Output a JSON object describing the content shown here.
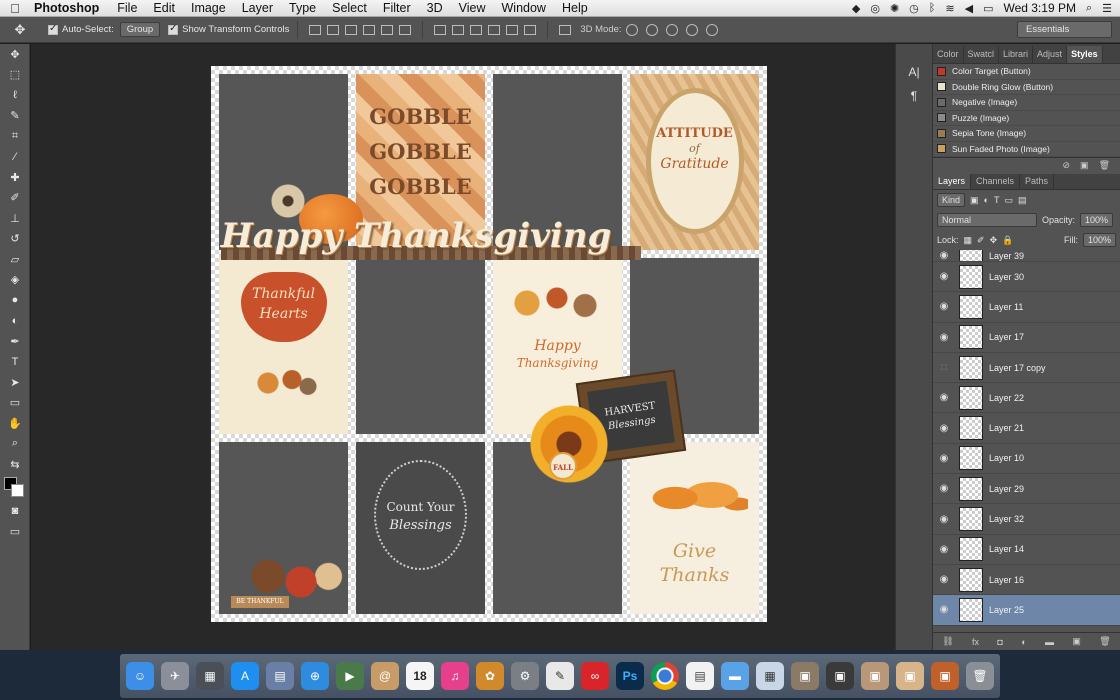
{
  "menubar": {
    "app": "Photoshop",
    "items": [
      "File",
      "Edit",
      "Image",
      "Layer",
      "Type",
      "Select",
      "Filter",
      "3D",
      "View",
      "Window",
      "Help"
    ],
    "clock": "Wed 3:19 PM"
  },
  "options": {
    "auto_select_label": "Auto-Select:",
    "auto_select_value": "Group",
    "transform_label": "Show Transform Controls",
    "mode3d_label": "3D Mode:",
    "workspace": "Essentials"
  },
  "canvas": {
    "cards": {
      "gobble": [
        "GOBBLE",
        "GOBBLE",
        "GOBBLE"
      ],
      "attitude": [
        "ATTITUDE",
        "of",
        "Gratitude"
      ],
      "banner": "Happy Thanksgiving",
      "thankful": [
        "Thankful",
        "Hearts"
      ],
      "happy": [
        "Happy",
        "Thanksgiving"
      ],
      "harvest": [
        "HARVEST",
        "Blessings"
      ],
      "tag": "FALL",
      "count": [
        "Count Your",
        "Blessings"
      ],
      "give": [
        "Give",
        "Thanks"
      ],
      "be_thankful": "BE THANKFUL"
    }
  },
  "styles_panel": {
    "tabs": [
      "Color",
      "Swatcl",
      "Librari",
      "Adjust",
      "Styles"
    ],
    "items": [
      {
        "name": "Color Target (Button)",
        "color": "#c0392b"
      },
      {
        "name": "Double Ring Glow (Button)",
        "color": "#e8e4c8"
      },
      {
        "name": "Negative (Image)",
        "color": "#6b6b6b"
      },
      {
        "name": "Puzzle (Image)",
        "color": "#8a8a8a"
      },
      {
        "name": "Sepia Tone (Image)",
        "color": "#9b7b4f"
      },
      {
        "name": "Sun Faded Photo (Image)",
        "color": "#c8a060"
      }
    ]
  },
  "layers_panel": {
    "tabs": [
      "Layers",
      "Channels",
      "Paths"
    ],
    "kind": "Kind",
    "blend_mode": "Normal",
    "opacity_label": "Opacity:",
    "opacity": "100%",
    "lock_label": "Lock:",
    "fill_label": "Fill:",
    "fill": "100%",
    "layers": [
      {
        "name": "Layer 39",
        "visible": true
      },
      {
        "name": "Layer 30",
        "visible": true
      },
      {
        "name": "Layer 11",
        "visible": true
      },
      {
        "name": "Layer 17",
        "visible": true
      },
      {
        "name": "Layer 17 copy",
        "visible": false
      },
      {
        "name": "Layer 22",
        "visible": true
      },
      {
        "name": "Layer 21",
        "visible": true
      },
      {
        "name": "Layer 10",
        "visible": true
      },
      {
        "name": "Layer 29",
        "visible": true
      },
      {
        "name": "Layer 32",
        "visible": true
      },
      {
        "name": "Layer 14",
        "visible": true
      },
      {
        "name": "Layer 16",
        "visible": true
      },
      {
        "name": "Layer 25",
        "visible": true,
        "selected": true
      }
    ]
  },
  "dock": {
    "icons": [
      {
        "name": "finder",
        "color": "#3c8ee6"
      },
      {
        "name": "launchpad",
        "color": "#8a8f99"
      },
      {
        "name": "mission-control",
        "color": "#4a4f58"
      },
      {
        "name": "app-store",
        "color": "#1f8ef1"
      },
      {
        "name": "preview",
        "color": "#6a7fa6"
      },
      {
        "name": "safari",
        "color": "#2d8ce0"
      },
      {
        "name": "facetime",
        "color": "#4a7a4a"
      },
      {
        "name": "contacts",
        "color": "#c89c66"
      },
      {
        "name": "calendar",
        "color": "#f5f5f5"
      },
      {
        "name": "itunes",
        "color": "#e6408c"
      },
      {
        "name": "photos",
        "color": "#d08a2c"
      },
      {
        "name": "system-preferences",
        "color": "#7a7f86"
      },
      {
        "name": "textedit",
        "color": "#e8e8e8"
      },
      {
        "name": "creative-cloud",
        "color": "#d9252a"
      },
      {
        "name": "photoshop",
        "color": "#0b2b4a"
      },
      {
        "name": "chrome",
        "color": "#3b9e5a"
      },
      {
        "name": "document",
        "color": "#f2f2f2"
      },
      {
        "name": "folder",
        "color": "#5aa2e6"
      },
      {
        "name": "sheet",
        "color": "#c8d6e8"
      },
      {
        "name": "image-file-1",
        "color": "#8a7a66"
      },
      {
        "name": "image-file-2",
        "color": "#3a3a3a"
      },
      {
        "name": "image-file-3",
        "color": "#b89878"
      },
      {
        "name": "image-file-4",
        "color": "#d8b48a"
      },
      {
        "name": "image-file-5",
        "color": "#c0602a"
      },
      {
        "name": "trash",
        "color": "#8a8f96"
      }
    ],
    "calendar_day": "18",
    "ps_label": "Ps"
  }
}
